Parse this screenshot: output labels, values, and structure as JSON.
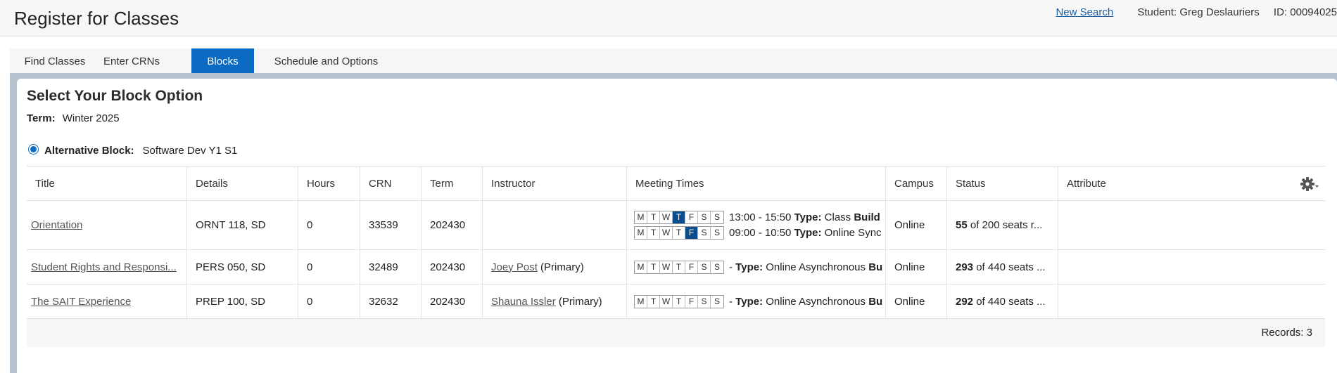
{
  "header": {
    "title": "Register for Classes",
    "new_search": "New Search",
    "student": "Student: Greg Deslauriers",
    "student_id": "ID: 00094025"
  },
  "tabs": [
    {
      "label": "Find Classes",
      "active": false
    },
    {
      "label": "Enter CRNs",
      "active": false
    },
    {
      "label": "Blocks",
      "active": true
    },
    {
      "label": "Schedule and Options",
      "active": false
    }
  ],
  "panel": {
    "title": "Select Your Block Option",
    "term_label": "Term:",
    "term_value": "Winter 2025",
    "block_label": "Alternative Block:",
    "block_value": "Software Dev Y1 S1"
  },
  "table": {
    "columns": [
      "Title",
      "Details",
      "Hours",
      "CRN",
      "Term",
      "Instructor",
      "Meeting Times",
      "Campus",
      "Status",
      "Attribute"
    ],
    "day_letters": [
      "M",
      "T",
      "W",
      "T",
      "F",
      "S",
      "S"
    ],
    "rows": [
      {
        "title": "Orientation",
        "details": "ORNT 118, SD",
        "hours": "0",
        "crn": "33539",
        "term": "202430",
        "instructor": "",
        "instructor_role": "",
        "meetings": [
          {
            "active_days": [
              3
            ],
            "time": "13:00 - 15:50",
            "type_label": "Type:",
            "type_value": "Class",
            "extra": "Build"
          },
          {
            "active_days": [
              4
            ],
            "time": "09:00 - 10:50",
            "type_label": "Type:",
            "type_value": "Online Sync",
            "extra": ""
          }
        ],
        "campus": "Online",
        "status_count": "55",
        "status_text": "of 200 seats r...",
        "attribute": ""
      },
      {
        "title": "Student Rights and Responsi...",
        "details": "PERS 050, SD",
        "hours": "0",
        "crn": "32489",
        "term": "202430",
        "instructor": "Joey Post",
        "instructor_role": "(Primary)",
        "meetings": [
          {
            "active_days": [],
            "time": "-",
            "type_label": "Type:",
            "type_value": "Online Asynchronous",
            "extra": "Bu"
          }
        ],
        "campus": "Online",
        "status_count": "293",
        "status_text": "of 440 seats ...",
        "attribute": ""
      },
      {
        "title": "The SAIT Experience",
        "details": "PREP 100, SD",
        "hours": "0",
        "crn": "32632",
        "term": "202430",
        "instructor": "Shauna Issler",
        "instructor_role": "(Primary)",
        "meetings": [
          {
            "active_days": [],
            "time": "-",
            "type_label": "Type:",
            "type_value": "Online Asynchronous",
            "extra": "Bu"
          }
        ],
        "campus": "Online",
        "status_count": "292",
        "status_text": "of 440 seats ...",
        "attribute": ""
      }
    ]
  },
  "footer": {
    "records": "Records: 3"
  },
  "icons": {
    "settings": "gear-icon",
    "radio": "radio-selected"
  },
  "colors": {
    "accent": "#0b6bc3",
    "active_day": "#0b4c8c",
    "link": "#1d5fa3"
  }
}
